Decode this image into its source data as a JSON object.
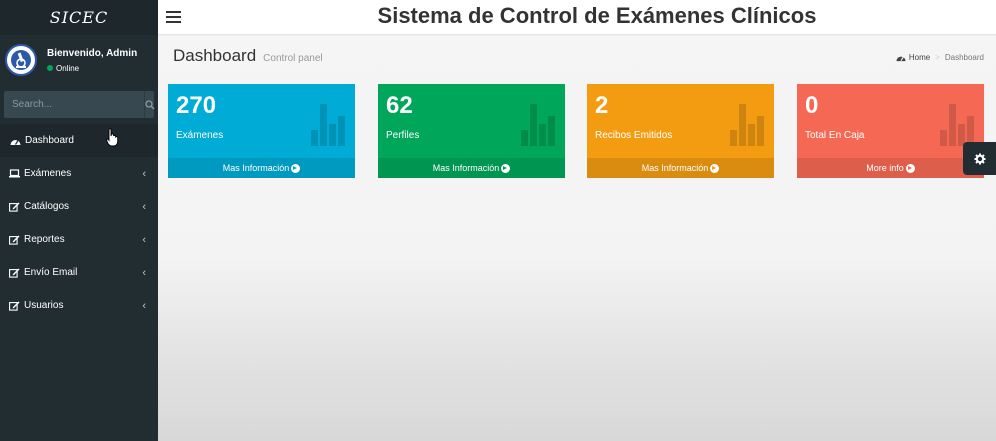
{
  "sidebar": {
    "logo": "SICEC",
    "user": {
      "name": "Bienvenido, Admin",
      "status": "Online"
    },
    "search": {
      "placeholder": "Search..."
    },
    "items": [
      {
        "label": "Dashboard",
        "icon": "dashboard-icon"
      },
      {
        "label": "Exámenes",
        "icon": "laptop-icon"
      },
      {
        "label": "Catálogos",
        "icon": "edit-icon"
      },
      {
        "label": "Reportes",
        "icon": "edit-icon"
      },
      {
        "label": "Envío Email",
        "icon": "edit-icon"
      },
      {
        "label": "Usuarios",
        "icon": "edit-icon"
      }
    ]
  },
  "header": {
    "title": "Sistema de Control de Exámenes Clínicos"
  },
  "content": {
    "title": "Dashboard",
    "subtitle": "Control panel",
    "breadcrumb": {
      "home": "Home",
      "current": "Dashboard"
    }
  },
  "boxes": [
    {
      "value": "270",
      "label": "Exámenes",
      "footer": "Mas Información",
      "color": "#00acd6"
    },
    {
      "value": "62",
      "label": "Perfiles",
      "footer": "Mas Información",
      "color": "#00a65a"
    },
    {
      "value": "2",
      "label": "Recibos Emitidos",
      "footer": "Mas Información",
      "color": "#f39c12"
    },
    {
      "value": "0",
      "label": "Total En Caja",
      "footer": "More info",
      "color": "#f56954"
    }
  ],
  "colors": {
    "sidebar": "#222d32",
    "sidebar_dark": "#1e282c",
    "accent": "#3c8dbc"
  }
}
